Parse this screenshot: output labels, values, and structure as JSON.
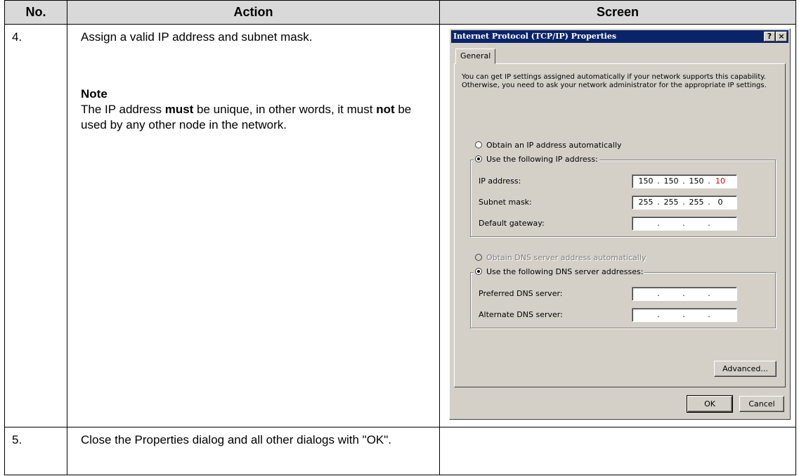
{
  "table": {
    "headers": [
      "No.",
      "Action",
      "Screen"
    ],
    "rows": [
      {
        "no": "4.",
        "action": "Assign a valid IP address and subnet mask.",
        "note_heading": "Note",
        "note_part1": "The IP address ",
        "note_bold1": "must",
        "note_part2": " be unique, in other words, it must ",
        "note_bold2": "not",
        "note_part3": " be used by any other node in the network."
      },
      {
        "no": "5.",
        "action": "Close the Properties dialog and all other dialogs with \"OK\"."
      }
    ]
  },
  "dialog": {
    "title": "Internet Protocol (TCP/IP) Properties",
    "help_btn": "?",
    "close_btn": "×",
    "tab": "General",
    "intro": "You can get IP settings assigned automatically if your network supports this capability. Otherwise, you need to ask your network administrator for the appropriate IP settings.",
    "radio_auto_ip": "Obtain an IP address automatically",
    "radio_manual_ip": "Use the following IP address:",
    "ip_label": "IP address:",
    "ip_value": [
      "150",
      "150",
      "150",
      "10"
    ],
    "subnet_label": "Subnet mask:",
    "subnet_value": [
      "255",
      "255",
      "255",
      "0"
    ],
    "gateway_label": "Default gateway:",
    "radio_auto_dns": "Obtain DNS server address automatically",
    "radio_manual_dns": "Use the following DNS server addresses:",
    "preferred_dns_label": "Preferred DNS server:",
    "alternate_dns_label": "Alternate DNS server:",
    "dot": ".",
    "advanced_btn": "Advanced...",
    "ok_btn": "OK",
    "cancel_btn": "Cancel",
    "colors": {
      "titlebar": "#0a246a",
      "face": "#d4d0c8",
      "highlight_octet": "#e00000"
    }
  }
}
